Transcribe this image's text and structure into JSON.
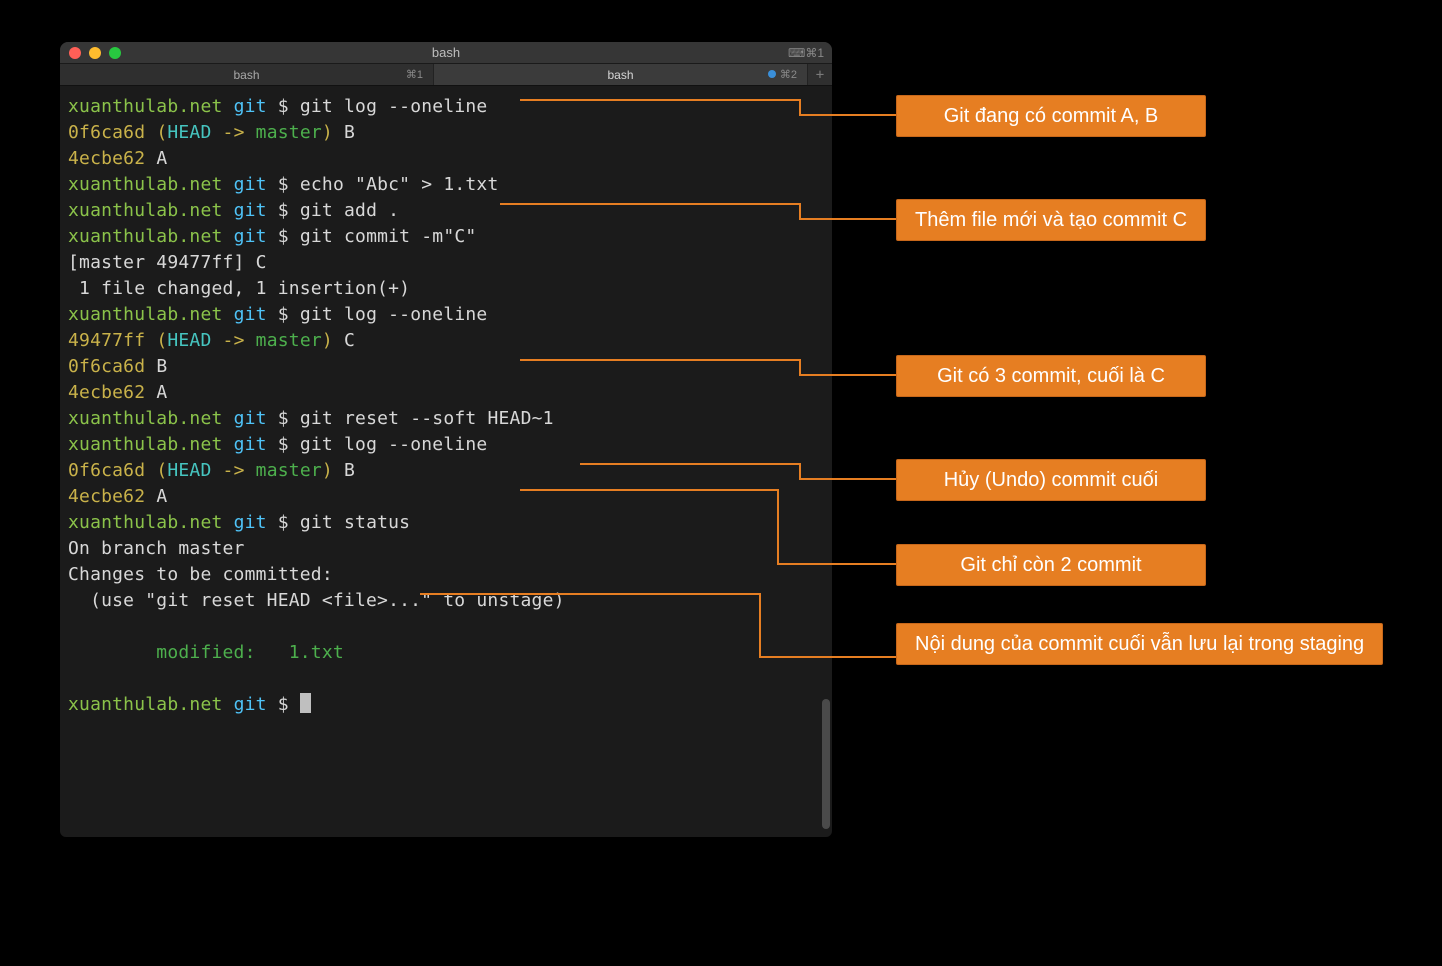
{
  "window": {
    "title": "bash",
    "shortcut_hint": "⌨⌘1",
    "tabs": [
      {
        "label": "bash",
        "shortcut": "⌘1",
        "active": false,
        "dirty": false
      },
      {
        "label": "bash",
        "shortcut": "⌘2",
        "active": true,
        "dirty": true
      }
    ],
    "plus": "+"
  },
  "prompt": {
    "host": "xuanthulab.net",
    "path": "git",
    "symbol": "$"
  },
  "terminal_lines": [
    {
      "type": "prompt",
      "cmd": "git log --oneline"
    },
    {
      "type": "commit",
      "hash": "0f6ca6d",
      "head": true,
      "branch": "master",
      "msg": "B"
    },
    {
      "type": "commit",
      "hash": "4ecbe62",
      "head": false,
      "msg": "A"
    },
    {
      "type": "prompt",
      "cmd": "echo \"Abc\" > 1.txt"
    },
    {
      "type": "prompt",
      "cmd": "git add ."
    },
    {
      "type": "prompt",
      "cmd": "git commit -m\"C\""
    },
    {
      "type": "output",
      "text": "[master 49477ff] C"
    },
    {
      "type": "output",
      "text": " 1 file changed, 1 insertion(+)"
    },
    {
      "type": "prompt",
      "cmd": "git log --oneline"
    },
    {
      "type": "commit",
      "hash": "49477ff",
      "head": true,
      "branch": "master",
      "msg": "C"
    },
    {
      "type": "commit",
      "hash": "0f6ca6d",
      "head": false,
      "msg": "B"
    },
    {
      "type": "commit",
      "hash": "4ecbe62",
      "head": false,
      "msg": "A"
    },
    {
      "type": "prompt",
      "cmd": "git reset --soft HEAD~1"
    },
    {
      "type": "prompt",
      "cmd": "git log --oneline"
    },
    {
      "type": "commit",
      "hash": "0f6ca6d",
      "head": true,
      "branch": "master",
      "msg": "B"
    },
    {
      "type": "commit",
      "hash": "4ecbe62",
      "head": false,
      "msg": "A"
    },
    {
      "type": "prompt",
      "cmd": "git status"
    },
    {
      "type": "output",
      "text": "On branch master"
    },
    {
      "type": "output",
      "text": "Changes to be committed:"
    },
    {
      "type": "output",
      "text": "  (use \"git reset HEAD <file>...\" to unstage)"
    },
    {
      "type": "blank"
    },
    {
      "type": "green",
      "text": "        modified:   1.txt"
    },
    {
      "type": "blank"
    },
    {
      "type": "prompt",
      "cmd": "",
      "cursor": true
    }
  ],
  "callouts": [
    {
      "text": "Git đang có commit A, B"
    },
    {
      "text": "Thêm file mới và tạo commit C"
    },
    {
      "text": "Git có 3 commit, cuối là C"
    },
    {
      "text": "Hủy (Undo) commit cuối"
    },
    {
      "text": "Git chỉ còn 2 commit"
    },
    {
      "text": "Nội dung của commit cuối vẫn lưu lại trong staging"
    }
  ],
  "labels": {
    "head": "HEAD",
    "arrow": " -> "
  }
}
